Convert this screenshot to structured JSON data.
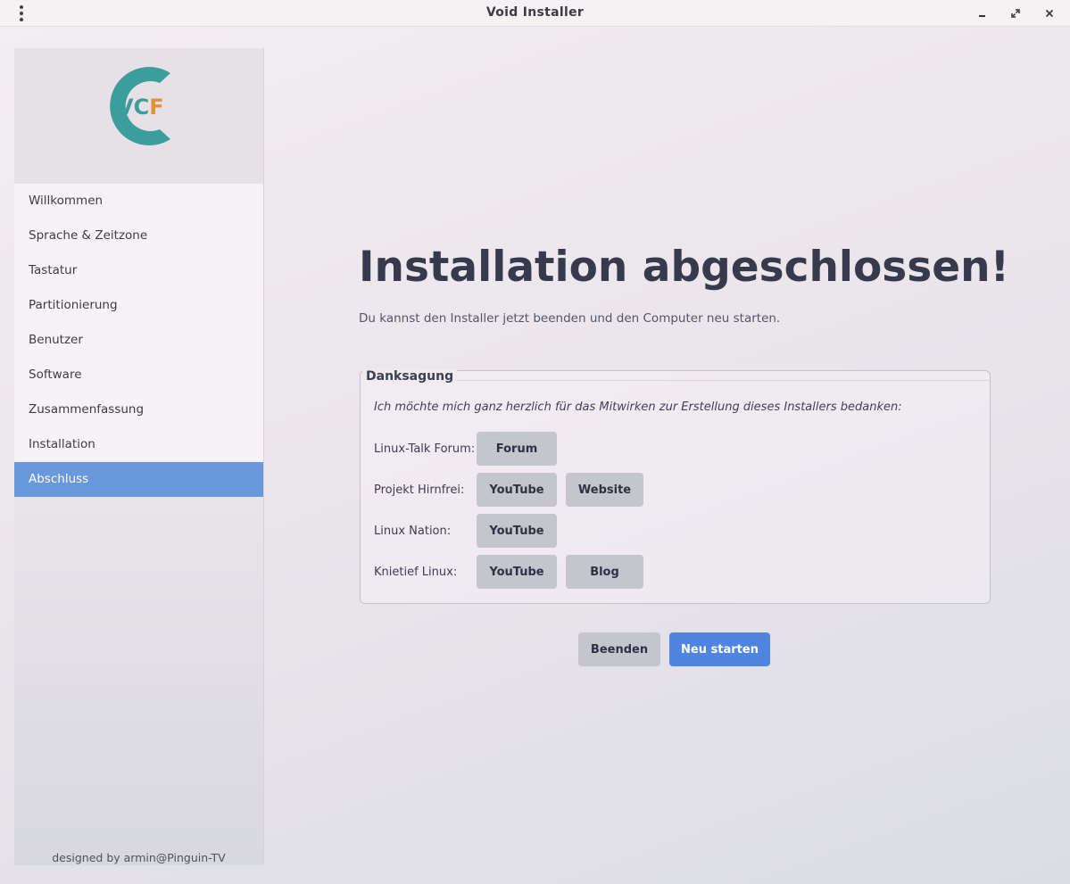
{
  "window": {
    "title": "Void Installer"
  },
  "logo": {
    "text_v": "V",
    "text_c": "C",
    "text_f": "F",
    "colors": {
      "ring": "#3c9e9c",
      "vc": "#3c9e9c",
      "f": "#e0913a"
    }
  },
  "sidebar": {
    "items": [
      {
        "label": "Willkommen"
      },
      {
        "label": "Sprache & Zeitzone"
      },
      {
        "label": "Tastatur"
      },
      {
        "label": "Partitionierung"
      },
      {
        "label": "Benutzer"
      },
      {
        "label": "Software"
      },
      {
        "label": "Zusammenfassung"
      },
      {
        "label": "Installation"
      },
      {
        "label": "Abschluss",
        "active": true
      }
    ],
    "credit": "designed by armin@Pinguin-TV"
  },
  "main": {
    "title": "Installation abgeschlossen!",
    "subtitle": "Du kannst den Installer jetzt beenden und den Computer neu starten."
  },
  "thanks": {
    "legend": "Danksagung",
    "text": "Ich möchte mich ganz herzlich für das Mitwirken zur Erstellung dieses Installers bedanken:",
    "rows": [
      {
        "label": "Linux-Talk Forum:",
        "buttons": [
          "Forum"
        ]
      },
      {
        "label": "Projekt Hirnfrei:",
        "buttons": [
          "YouTube",
          "Website"
        ]
      },
      {
        "label": "Linux Nation:",
        "buttons": [
          "YouTube"
        ]
      },
      {
        "label": "Knietief Linux:",
        "buttons": [
          "YouTube",
          "Blog"
        ]
      }
    ]
  },
  "actions": {
    "quit": "Beenden",
    "restart": "Neu starten"
  },
  "colors": {
    "accent": "#6a98dd",
    "primary_button": "#4f84df"
  }
}
